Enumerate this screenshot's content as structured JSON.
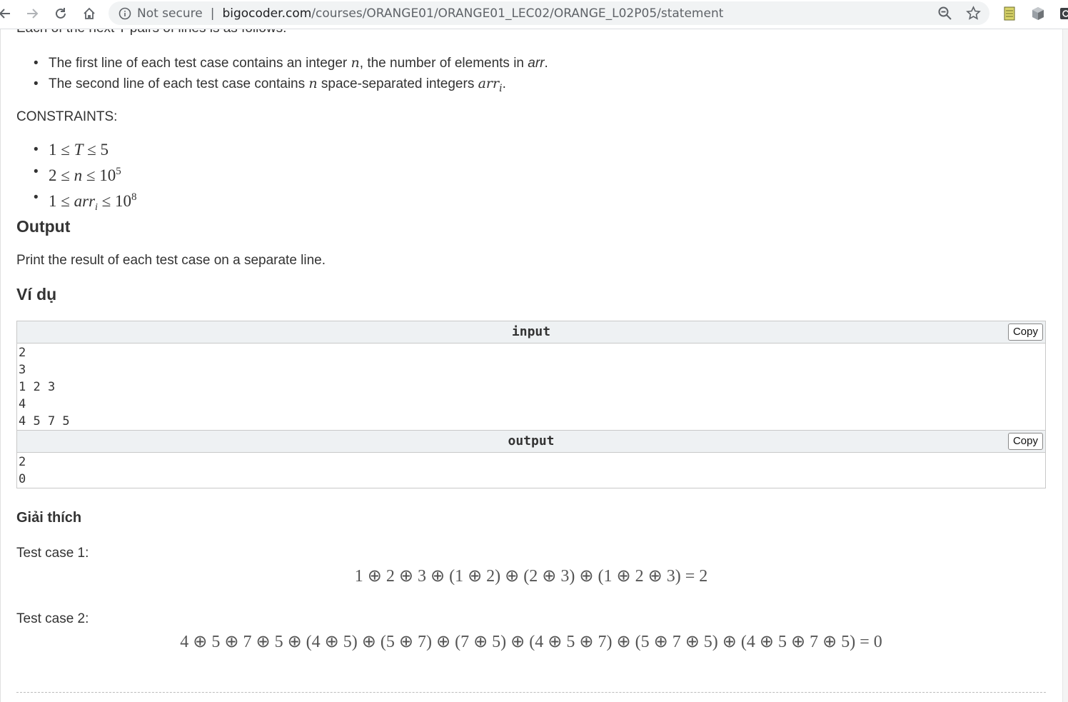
{
  "browser": {
    "security_label": "Not secure",
    "url_domain": "bigocoder.com",
    "url_path": "/courses/ORANGE01/ORANGE01_LEC02/ORANGE_L02P05/statement",
    "icons": [
      "back-icon",
      "forward-icon",
      "reload-icon",
      "home-icon",
      "info-icon",
      "zoom-icon",
      "star-icon",
      "notes-extension-icon",
      "cube-extension-icon",
      "extension-icon"
    ]
  },
  "statement": {
    "cut_line": "Each of the next T pairs of lines is as follows:",
    "input_lines": [
      {
        "pre": "The first line of each test case contains an integer ",
        "var": "n",
        "mid": ", the number of elements in ",
        "em": "arr",
        "post": "."
      },
      {
        "pre": "The second line of each test case contains ",
        "var": "n",
        "mid": " space-separated integers ",
        "var2": "arr",
        "sub": "i",
        "post": "."
      }
    ],
    "constraints_label": "CONSTRAINTS:",
    "constraints": [
      {
        "left": "1 ≤ ",
        "var": "T",
        "right": " ≤ 5",
        "sup": ""
      },
      {
        "left": "2 ≤ ",
        "var": "n",
        "right": " ≤ 10",
        "sup": "5"
      },
      {
        "left": "1 ≤ ",
        "var": "arr",
        "sub": "i",
        "right": " ≤ 10",
        "sup": "8"
      }
    ],
    "output_heading": "Output",
    "output_text": "Print the result of each test case on a separate line.",
    "example_heading": "Ví dụ"
  },
  "samples": {
    "input_title": "input",
    "input_body": "2\n3\n1 2 3\n4\n4 5 7 5",
    "output_title": "output",
    "output_body": "2\n0",
    "copy_label": "Copy"
  },
  "explanation": {
    "heading": "Giải thích",
    "case1_label": "Test case 1:",
    "case1_formula": "1 ⊕ 2 ⊕ 3 ⊕ (1 ⊕ 2) ⊕ (2 ⊕ 3) ⊕ (1 ⊕ 2 ⊕ 3) = 2",
    "case2_label": "Test case 2:",
    "case2_formula": "4 ⊕ 5 ⊕ 7 ⊕ 5 ⊕ (4 ⊕ 5) ⊕ (5 ⊕ 7) ⊕ (7 ⊕ 5) ⊕ (4 ⊕ 5 ⊕ 7) ⊕ (5 ⊕ 7 ⊕ 5) ⊕ (4 ⊕ 5 ⊕ 7 ⊕ 5) = 0"
  }
}
